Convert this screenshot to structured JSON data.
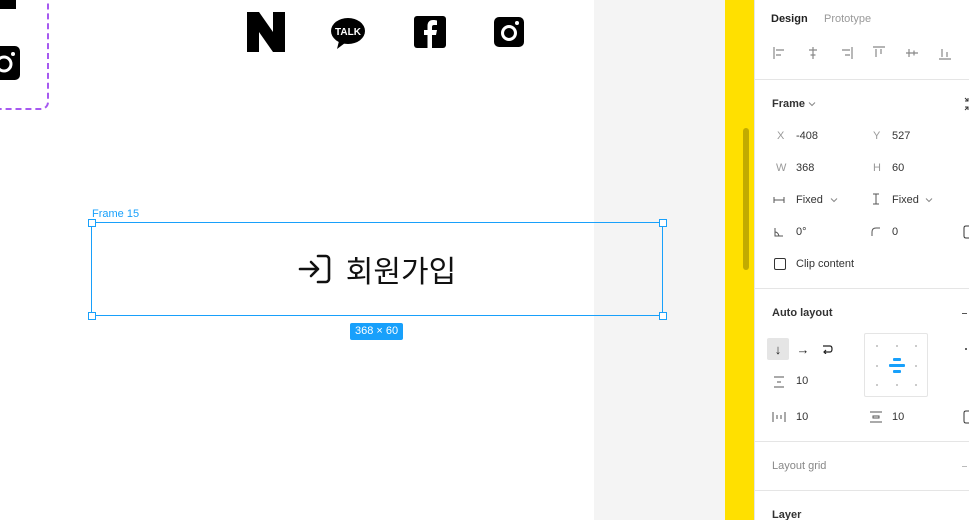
{
  "canvas": {
    "icons": [
      "naver-icon",
      "kakaotalk-icon",
      "facebook-icon",
      "instagram-icon"
    ],
    "talk_label": "TALK",
    "frame": {
      "name": "Frame 15",
      "button_label": "회원가입",
      "size_badge": "368 × 60"
    }
  },
  "panel": {
    "tabs": {
      "design": "Design",
      "prototype": "Prototype"
    },
    "frame": {
      "title": "Frame",
      "x_label": "X",
      "x": "-408",
      "y_label": "Y",
      "y": "527",
      "w_label": "W",
      "w": "368",
      "h_label": "H",
      "h": "60",
      "width_mode": "Fixed",
      "height_mode": "Fixed",
      "rotation": "0°",
      "radius": "0",
      "clip_label": "Clip content"
    },
    "auto_layout": {
      "title": "Auto layout",
      "spacing": "10",
      "padding_horizontal": "10",
      "padding_vertical": "10"
    },
    "layout_grid": {
      "title": "Layout grid"
    },
    "layer": {
      "title": "Layer"
    }
  },
  "colors": {
    "selection": "#18a0fb",
    "component_dash": "#a659f0",
    "strip": "#ffe000"
  }
}
